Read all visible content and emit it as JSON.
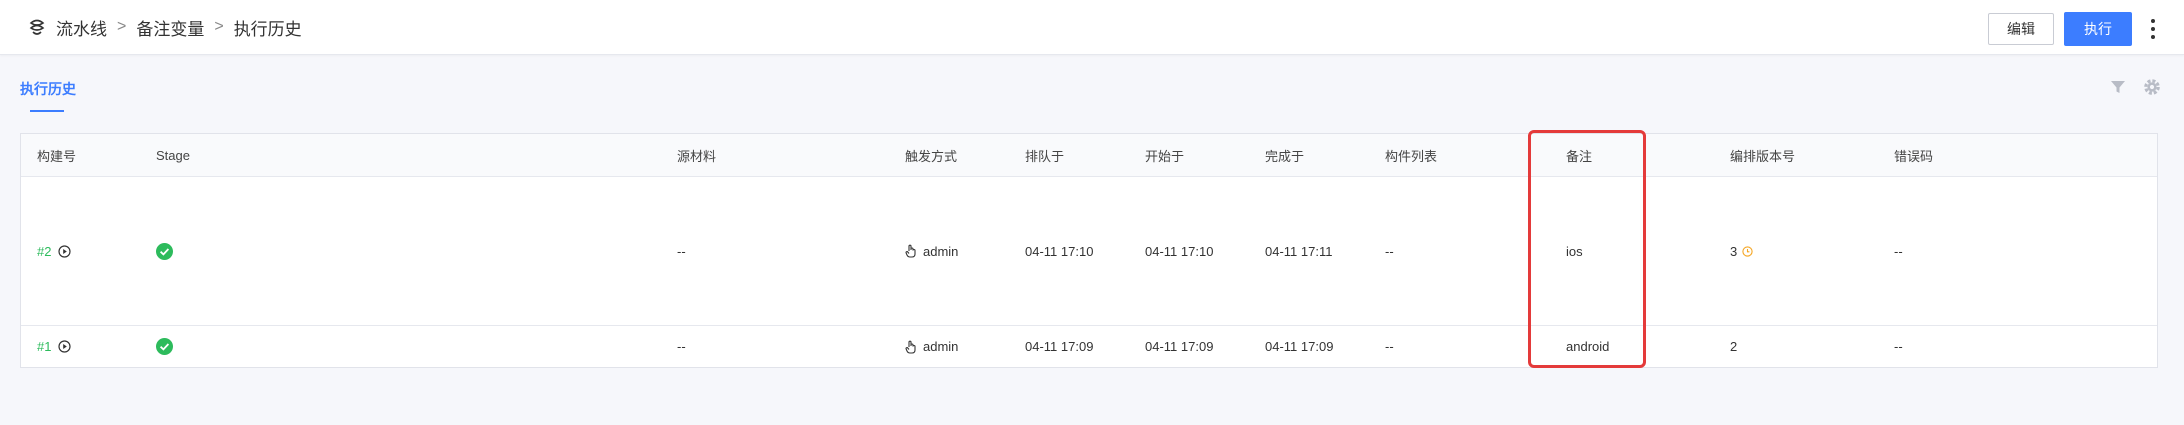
{
  "breadcrumb": {
    "items": [
      "流水线",
      "备注变量",
      "执行历史"
    ],
    "separator": ">"
  },
  "header_actions": {
    "edit_label": "编辑",
    "run_label": "执行"
  },
  "tabs": [
    {
      "label": "执行历史",
      "active": true
    }
  ],
  "toolbar_icons": [
    "filter-icon",
    "gear-icon"
  ],
  "table": {
    "columns": [
      "构建号",
      "Stage",
      "源材料",
      "触发方式",
      "排队于",
      "开始于",
      "完成于",
      "构件列表",
      "备注",
      "编排版本号",
      "错误码"
    ],
    "rows": [
      {
        "build": "#2",
        "stage_status": "success",
        "source": "--",
        "trigger": "admin",
        "queued": "04-11 17:10",
        "started": "04-11 17:10",
        "finished": "04-11 17:11",
        "artifacts": "--",
        "remark": "ios",
        "version": "3",
        "version_warning": true,
        "error_code": "--"
      },
      {
        "build": "#1",
        "stage_status": "success",
        "source": "--",
        "trigger": "admin",
        "queued": "04-11 17:09",
        "started": "04-11 17:09",
        "finished": "04-11 17:09",
        "artifacts": "--",
        "remark": "android",
        "version": "2",
        "version_warning": false,
        "error_code": "--"
      }
    ]
  },
  "colors": {
    "accent": "#3c7dff",
    "success": "#2dbb5c",
    "highlight": "#e43a3a",
    "warning": "#f5a623"
  }
}
